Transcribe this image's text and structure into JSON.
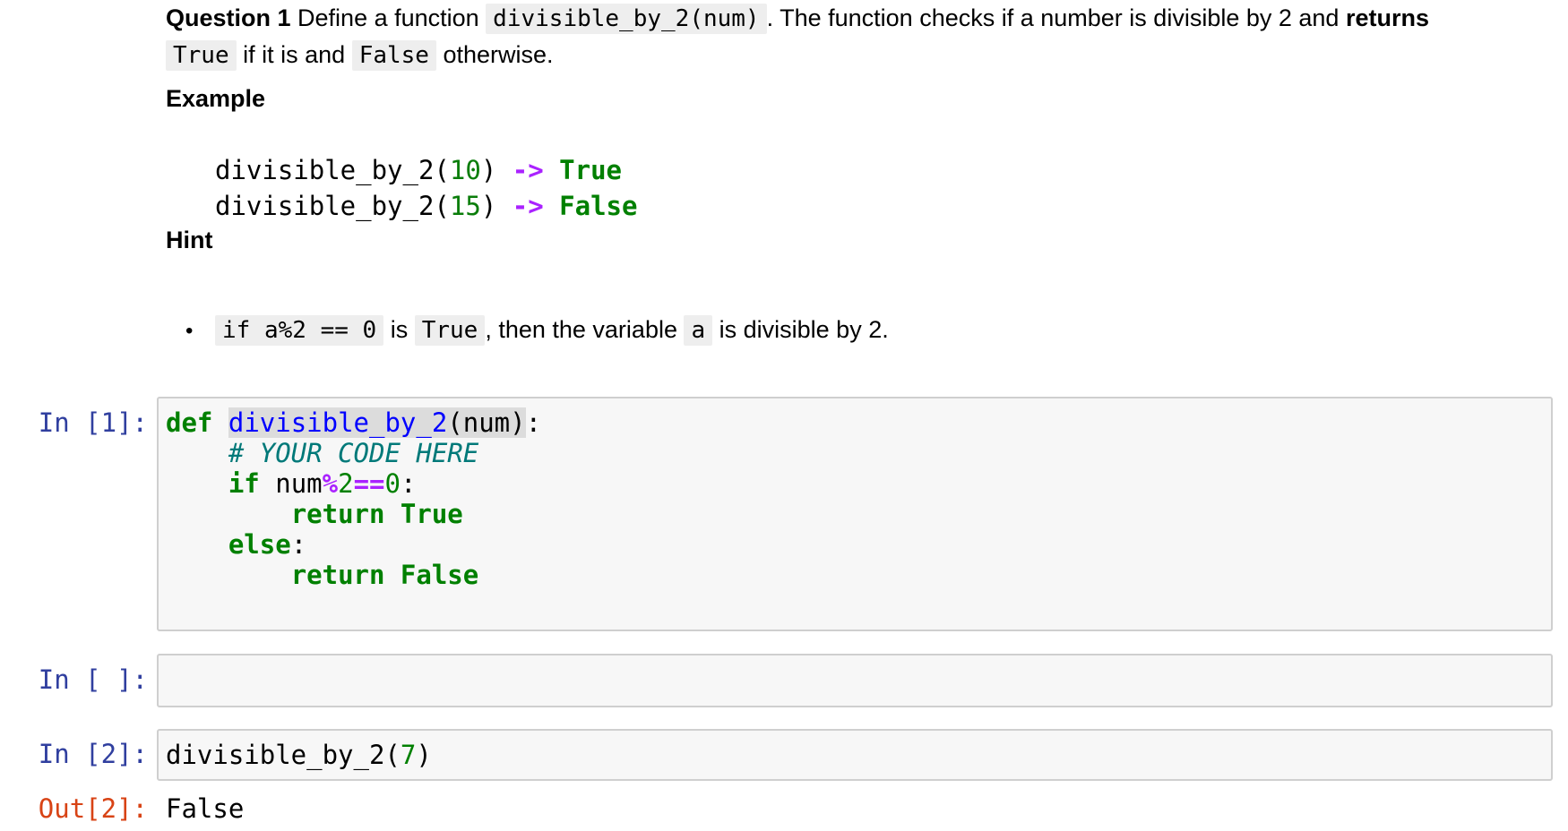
{
  "question": {
    "label": "Question 1",
    "text1": " Define a function ",
    "func_sig": "divisible_by_2(num)",
    "text2": ". The function checks if a number is divisible by 2 and ",
    "returns": "returns",
    "true_code": "True",
    "text3": " if it is and ",
    "false_code": "False",
    "text4": " otherwise."
  },
  "example": {
    "heading": "Example",
    "lines": [
      {
        "call": "divisible_by_2(",
        "arg": "10",
        "close": ")",
        "arrow": "->",
        "result": "True"
      },
      {
        "call": "divisible_by_2(",
        "arg": "15",
        "close": ")",
        "arrow": "->",
        "result": "False"
      }
    ]
  },
  "hint": {
    "heading": "Hint",
    "bullet": "•",
    "code1": "if a%2 == 0",
    "text1": " is ",
    "code2": "True",
    "text2": ", then the variable ",
    "code3": "a",
    "text3": " is divisible by 2."
  },
  "cells": {
    "c1": {
      "prompt": "In [1]:",
      "def": "def",
      "fname": "divisible_by_2",
      "params": "(num)",
      "colon": ":",
      "comment": "# YOUR CODE HERE",
      "if_kw": "if",
      "var": "num",
      "mod": "%",
      "two": "2",
      "eq": "==",
      "zero": "0",
      "return_kw": "return",
      "true_val": "True",
      "else_kw": "else",
      "false_val": "False"
    },
    "c2": {
      "prompt": "In [ ]:"
    },
    "c3": {
      "prompt": "In [2]:",
      "call": "divisible_by_2(",
      "arg": "7",
      "close": ")",
      "out_prompt": "Out[2]:",
      "output": "False"
    }
  }
}
